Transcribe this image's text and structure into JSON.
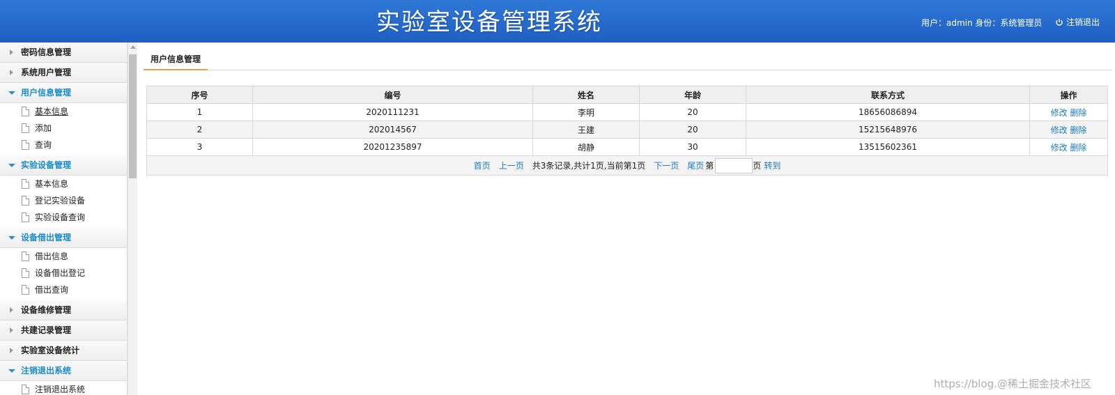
{
  "header": {
    "title": "实验室设备管理系统",
    "user_info": "用户：admin 身份：系统管理员",
    "logout_label": "注销退出"
  },
  "sidebar": {
    "groups": [
      {
        "label": "密码信息管理",
        "open": false,
        "items": []
      },
      {
        "label": "系统用户管理",
        "open": false,
        "items": []
      },
      {
        "label": "用户信息管理",
        "open": true,
        "items": [
          "基本信息",
          "添加",
          "查询"
        ]
      },
      {
        "label": "实验设备管理",
        "open": true,
        "items": [
          "基本信息",
          "登记实验设备",
          "实验设备查询"
        ]
      },
      {
        "label": "设备借出管理",
        "open": true,
        "items": [
          "借出信息",
          "设备借出登记",
          "借出查询"
        ]
      },
      {
        "label": "设备维修管理",
        "open": false,
        "items": []
      },
      {
        "label": "共建记录管理",
        "open": false,
        "items": []
      },
      {
        "label": "实验室设备统计",
        "open": false,
        "items": []
      },
      {
        "label": "注销退出系统",
        "open": true,
        "items": [
          "注销退出系统"
        ]
      }
    ]
  },
  "main": {
    "tab_label": "用户信息管理",
    "table": {
      "headers": [
        "序号",
        "编号",
        "姓名",
        "年龄",
        "联系方式",
        "操作"
      ],
      "rows": [
        [
          "1",
          "2020111231",
          "李明",
          "20",
          "18656086894"
        ],
        [
          "2",
          "202014567",
          "王建",
          "20",
          "15215648976"
        ],
        [
          "3",
          "20201235897",
          "胡静",
          "30",
          "13515602361"
        ]
      ],
      "edit_label": "修改",
      "delete_label": "删除"
    },
    "pager": {
      "first": "首页",
      "prev": "上一页",
      "info": "共3条记录,共计1页,当前第1页",
      "next": "下一页",
      "last": "尾页",
      "page_prefix": "第",
      "page_suffix": "页",
      "goto": "转到"
    }
  },
  "watermark": "https://blog.@稀土掘金技术社区",
  "colors": {
    "header_bg": "#2468cf",
    "link": "#1a7bc1",
    "open_group": "#1a8bc8",
    "tab_underline": "#e8a23a"
  }
}
